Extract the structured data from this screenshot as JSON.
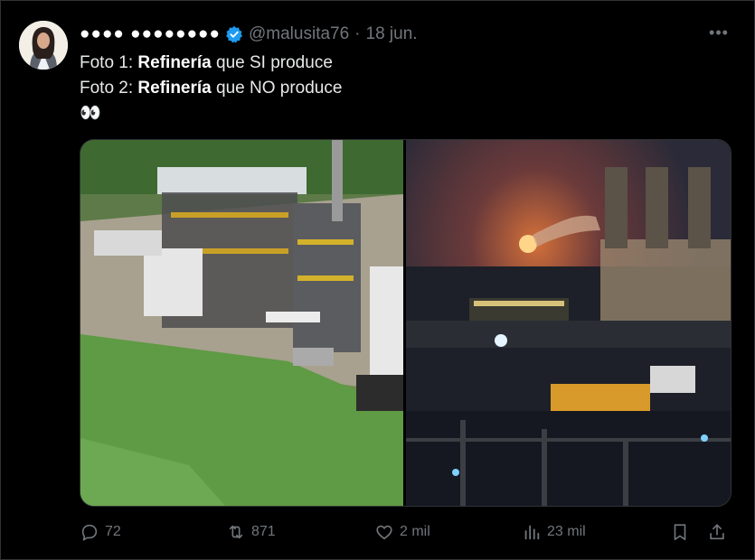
{
  "tweet": {
    "author_name": "●●●● ●●●●●●●●",
    "handle": "@malusita76",
    "separator": "·",
    "date": "18 jun.",
    "more_label": "•••",
    "line1": {
      "prefix": "Foto 1: ",
      "bold": "Refinería",
      "suffix": " que SI produce"
    },
    "line2": {
      "prefix": "Foto 2: ",
      "bold": "Refinería",
      "suffix": " que NO produce"
    },
    "emoji": "👀"
  },
  "media": {
    "photo1_icon": "refinery-daytime-photo",
    "photo2_icon": "refinery-night-photo"
  },
  "actions": {
    "replies": "72",
    "reposts": "871",
    "likes": "2 mil",
    "views": "23 mil"
  },
  "colors": {
    "background": "#000000",
    "text": "#e7e9ea",
    "muted": "#71767b",
    "verified": "#1d9bf0"
  }
}
